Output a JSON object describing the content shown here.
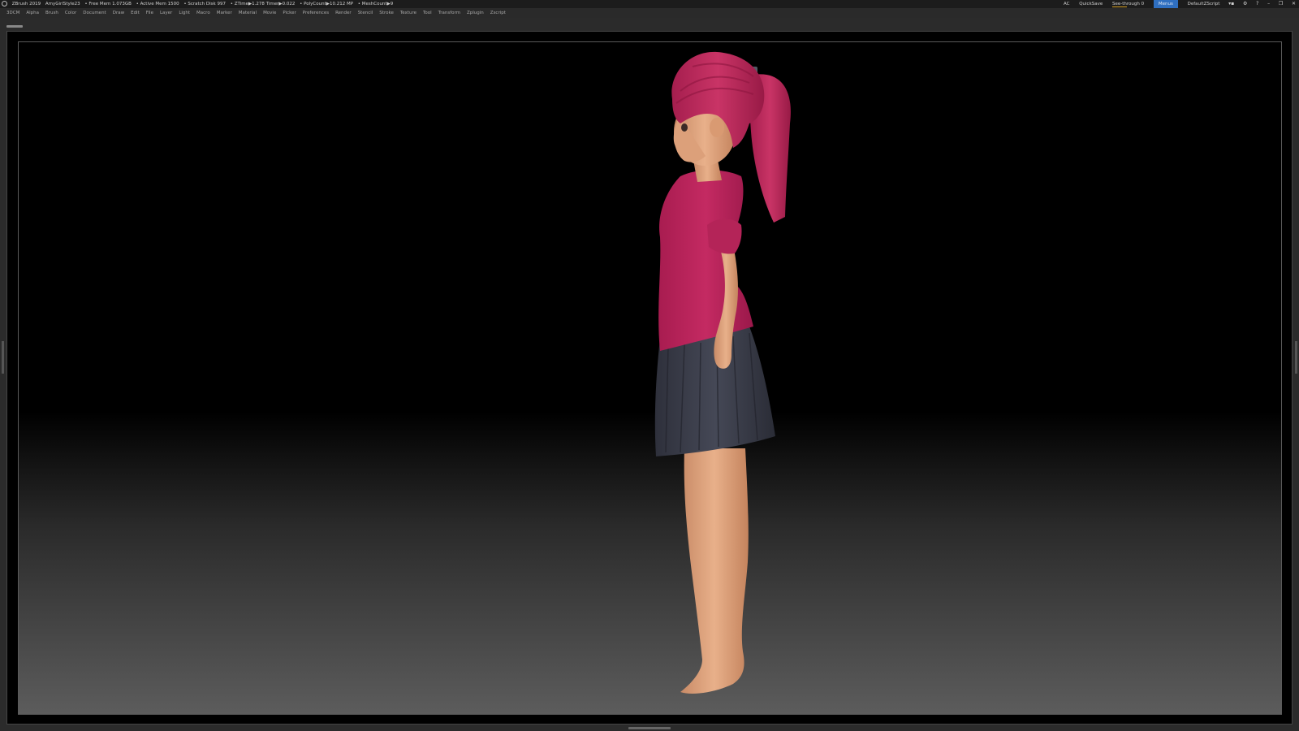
{
  "titlebar": {
    "app": "ZBrush 2019",
    "project": "AmyGirlStyle23",
    "free_mem": "• Free Mem 1.073GB",
    "active_mem": "• Active Mem 1500",
    "scratch_disk": "• Scratch Disk 997",
    "ztime": "• ZTime▶1.278 Timer▶0.022",
    "polycount": "• PolyCount▶10.212 MP",
    "meshcount": "• MeshCount▶9",
    "right": {
      "ac": "AC",
      "quicksave": "QuickSave",
      "see_through": "See-through  0",
      "see_through_level": 0,
      "menus_button": "Menus",
      "default_script": "DefaultZScript"
    }
  },
  "menubar": {
    "items": [
      "3DCM",
      "Alpha",
      "Brush",
      "Color",
      "Document",
      "Draw",
      "Edit",
      "File",
      "Layer",
      "Light",
      "Macro",
      "Marker",
      "Material",
      "Movie",
      "Picker",
      "Preferences",
      "Render",
      "Stencil",
      "Stroke",
      "Texture",
      "Tool",
      "Transform",
      "Zplugin",
      "Zscript"
    ]
  },
  "colors": {
    "shirt": "#b8225a",
    "hair": "#c02a5c",
    "skin": "#e0a37a",
    "skirt": "#3a3d4a",
    "accent": "#2f6fc0"
  }
}
